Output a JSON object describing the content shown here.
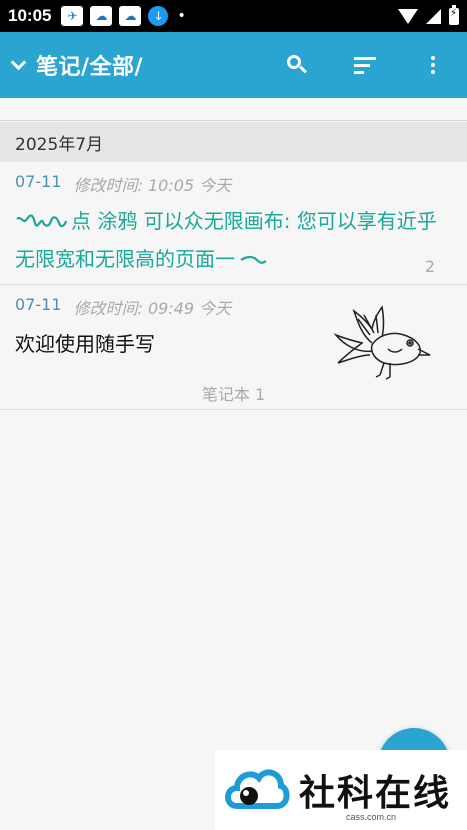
{
  "status_bar": {
    "time": "10:05",
    "icons": [
      "plane-icon",
      "cloud-icon",
      "cloud-icon",
      "download-icon",
      "dot-icon",
      "wifi-icon",
      "signal-icon",
      "battery-icon"
    ],
    "dot": "•"
  },
  "app_bar": {
    "title": "笔记/全部/",
    "accent_color": "#2aa5d1",
    "icons": [
      "chevron-down-icon",
      "search-icon",
      "sort-icon",
      "more-vert-icon"
    ]
  },
  "section": {
    "header": "2025年7月"
  },
  "notes": [
    {
      "date": "07-11",
      "modified": "修改时间: 10:05 今天",
      "body": "点 涂鸦 可以众无限画布: 您可以享有近乎无限宽和无限高的页面一",
      "count": "2",
      "text_color": "#1aa89a"
    },
    {
      "date": "07-11",
      "modified": "修改时间: 09:49 今天",
      "body": "欢迎使用随手写",
      "notebook": "笔记本 1"
    }
  ],
  "watermark": {
    "text": "社科在线",
    "sub": "cass.com.cn"
  }
}
